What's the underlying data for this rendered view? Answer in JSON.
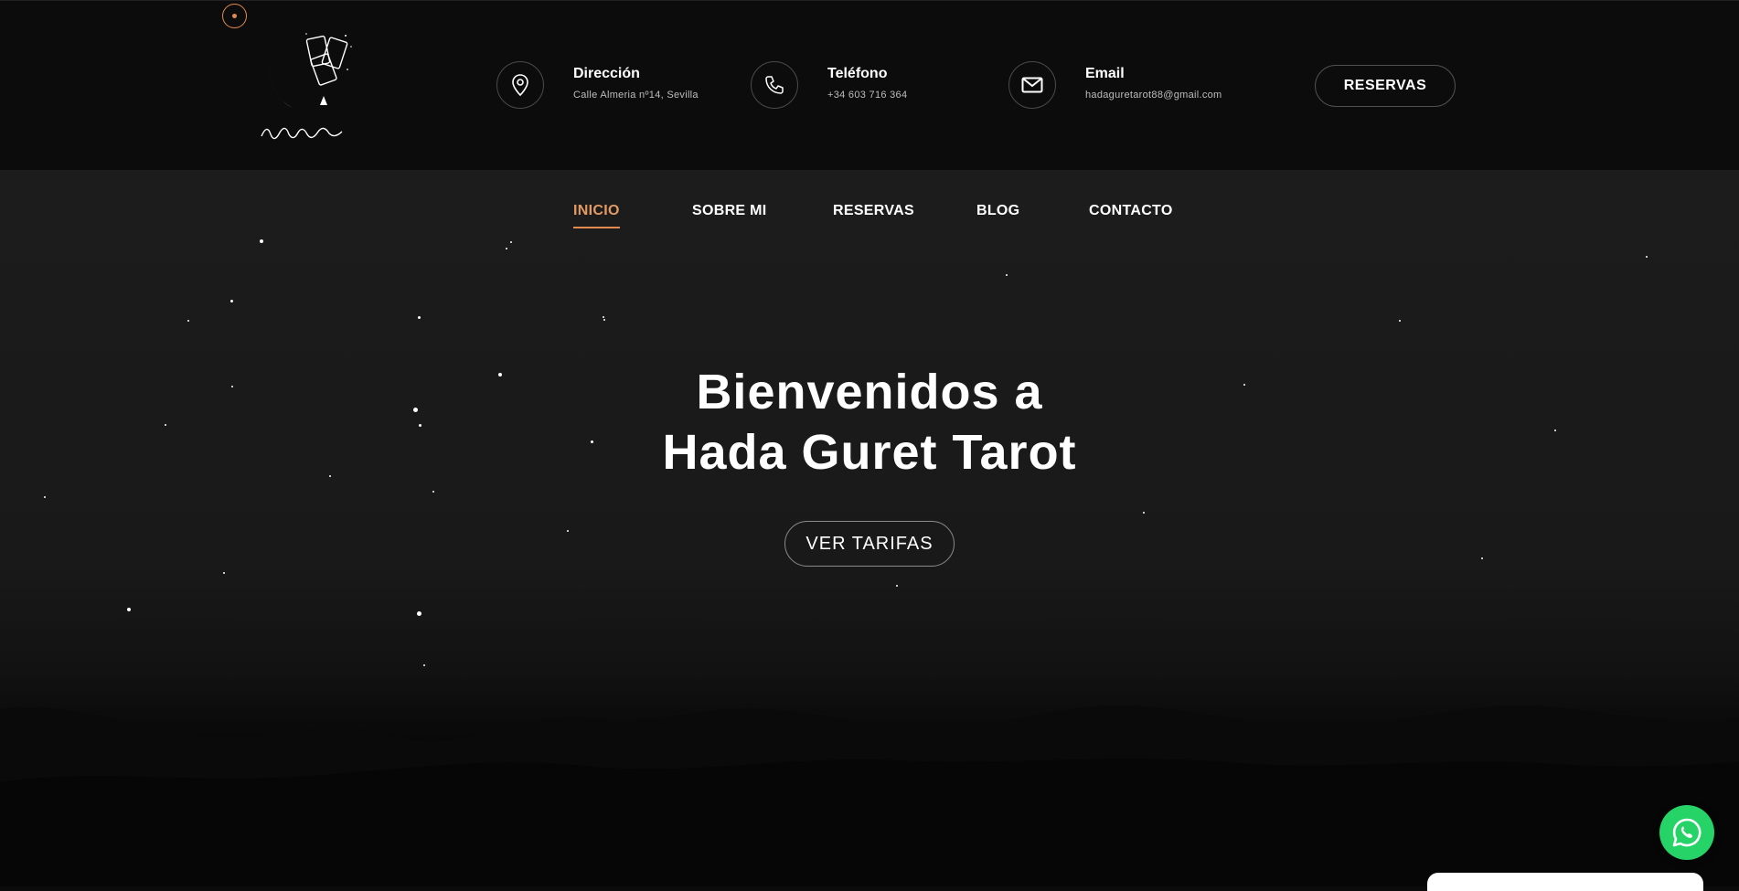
{
  "header": {
    "logo_alt": "Hada Guret Tarot",
    "info": [
      {
        "icon": "map-pin-icon",
        "title": "Dirección",
        "value": "Calle Almeria nº14, Sevilla"
      },
      {
        "icon": "phone-icon",
        "title": "Teléfono",
        "value": "+34 603 716 364"
      },
      {
        "icon": "envelope-icon",
        "title": "Email",
        "value": "hadaguretarot88@gmail.com"
      }
    ],
    "cta_label": "RESERVAS"
  },
  "nav": {
    "items": [
      {
        "label": "INICIO",
        "active": true
      },
      {
        "label": "SOBRE MI",
        "active": false
      },
      {
        "label": "RESERVAS",
        "active": false
      },
      {
        "label": "BLOG",
        "active": false
      },
      {
        "label": "CONTACTO",
        "active": false
      }
    ]
  },
  "hero": {
    "title_line1": "Bienvenidos a",
    "title_line2": "Hada Guret Tarot",
    "button_label": "VER TARIFAS"
  },
  "colors": {
    "accent": "#e38b4f",
    "background": "#0b0b0b",
    "whatsapp": "#25d366"
  }
}
